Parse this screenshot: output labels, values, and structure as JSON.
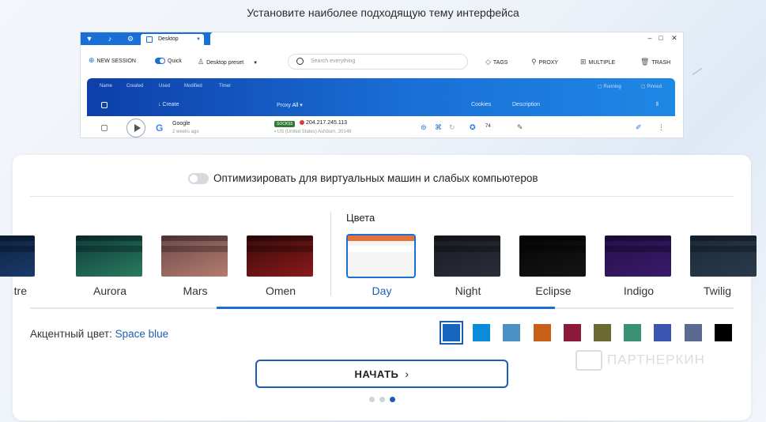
{
  "heading": "Установите наиболее подходящую тему интерфейса",
  "preview": {
    "tab_label": "Desktop",
    "toolbar": {
      "new_session": "NEW SESSION",
      "quick": "Quick",
      "preset": "Desktop preset",
      "search_placeholder": "Search everything",
      "tags": "TAGS",
      "proxy": "PROXY",
      "multiple": "MULTIPLE",
      "trash": "TRASH"
    },
    "table": {
      "filters": [
        "Name",
        "Created",
        "Used",
        "Modified",
        "Timer"
      ],
      "right_filters": [
        "Running",
        "Pinned"
      ],
      "columns": {
        "create": "Create",
        "proxy": "Proxy",
        "proxy_value": "All",
        "cookies": "Cookies",
        "description": "Description"
      },
      "row": {
        "name": "Google",
        "age": "2 weeks ago",
        "proxy_type": "SOCKS5",
        "ip": "204.217.245.113",
        "location": "US (United States) Ashburn, 20149",
        "cookies": "74"
      }
    }
  },
  "optimize_label": "Оптимизировать для виртуальных машин и слабых компьютеров",
  "colors_label": "Цвета",
  "themes": [
    {
      "name": "tre",
      "colors": [
        "#0b1e3a",
        "#1a3a6a"
      ]
    },
    {
      "name": "Aurora",
      "colors": [
        "#0e3b3a",
        "#2a7a5e"
      ]
    },
    {
      "name": "Mars",
      "colors": [
        "#6b4a4a",
        "#b47c6e"
      ]
    },
    {
      "name": "Omen",
      "colors": [
        "#3a0a0a",
        "#8a1a1a"
      ]
    },
    {
      "name": "Day",
      "colors": [
        "#f5f5f5",
        "#e05a1a"
      ]
    },
    {
      "name": "Night",
      "colors": [
        "#1a1c24",
        "#2a2d38"
      ]
    },
    {
      "name": "Eclipse",
      "colors": [
        "#050505",
        "#151515"
      ]
    },
    {
      "name": "Indigo",
      "colors": [
        "#24104a",
        "#3a1a6a"
      ]
    },
    {
      "name": "Twilig",
      "colors": [
        "#1a2a3a",
        "#2a3a4a"
      ]
    }
  ],
  "selected_theme": "Day",
  "accent_label": "Акцентный цвет:",
  "accent_value": "Space blue",
  "accent_swatches": [
    "#1565c0",
    "#0d8bdb",
    "#4a90c2",
    "#c8601a",
    "#8b1a3a",
    "#6b6a30",
    "#3a9070",
    "#3a56b0",
    "#5a6a90",
    "#000000"
  ],
  "start_button": "НАЧАТЬ",
  "pagination": {
    "total": 3,
    "active": 3
  },
  "watermark": "ПАРТНЕРКИН"
}
